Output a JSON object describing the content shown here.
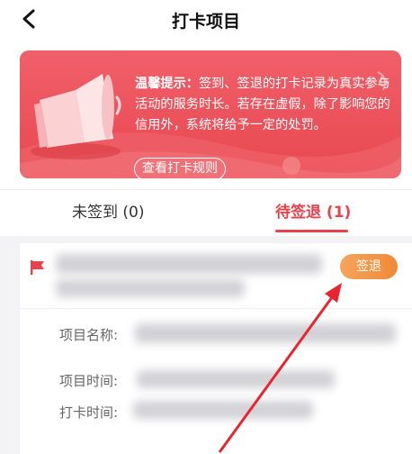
{
  "nav": {
    "title": "打卡项目"
  },
  "banner": {
    "tip_prefix": "温馨提示：",
    "tip_text": "签到、签退的打卡记录为真实参与活动的服务时长。若存在虚假，除了影响您的信用外，系统将给予一定的处罚。",
    "rules_button": "查看打卡规则"
  },
  "tabs": [
    {
      "label": "未签到 (0)",
      "active": false
    },
    {
      "label": "待签退 (1)",
      "active": true
    }
  ],
  "record": {
    "signout_button": "签退",
    "project_name_label": "项目名称:",
    "project_time_label": "项目时间:",
    "checkin_time_label": "打卡时间:"
  },
  "colors": {
    "accent": "#e8434d",
    "banner": "#ec5159",
    "button": "#f09444"
  }
}
